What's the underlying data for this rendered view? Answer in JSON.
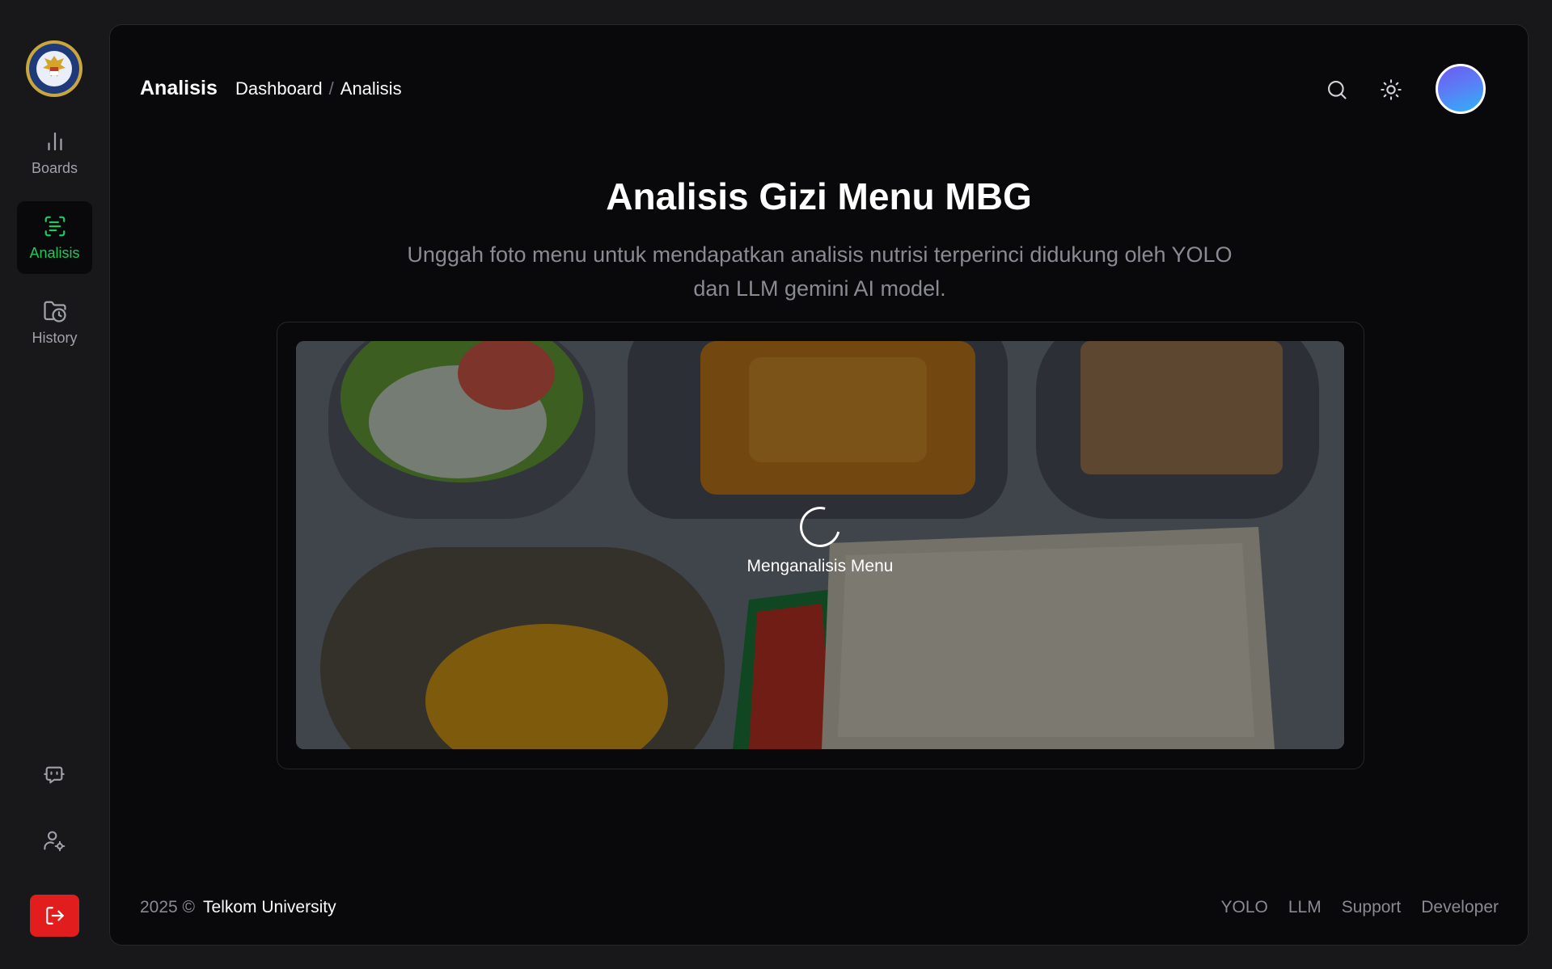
{
  "sidebar": {
    "items": [
      {
        "label": "Boards",
        "icon": "bar-chart-icon",
        "active": false
      },
      {
        "label": "Analisis",
        "icon": "scan-text-icon",
        "active": true
      },
      {
        "label": "History",
        "icon": "folder-clock-icon",
        "active": false
      }
    ],
    "bottom_icons": [
      "chat-bot-icon",
      "user-settings-icon",
      "logout-icon"
    ]
  },
  "header": {
    "title": "Analisis",
    "breadcrumb": [
      "Dashboard",
      "/",
      "Analisis"
    ]
  },
  "main": {
    "title": "Analisis Gizi Menu MBG",
    "subtitle": "Unggah foto menu untuk mendapatkan analisis nutrisi terperinci didukung oleh YOLO dan LLM gemini AI model.",
    "loading_text": "Menganalisis Menu"
  },
  "footer": {
    "copyright": "2025 ©",
    "organization": "Telkom University",
    "links": [
      "YOLO",
      "LLM",
      "Support",
      "Developer"
    ]
  },
  "colors": {
    "accent": "#22c55e",
    "logout": "#e11d1d",
    "background": "#09090b"
  }
}
